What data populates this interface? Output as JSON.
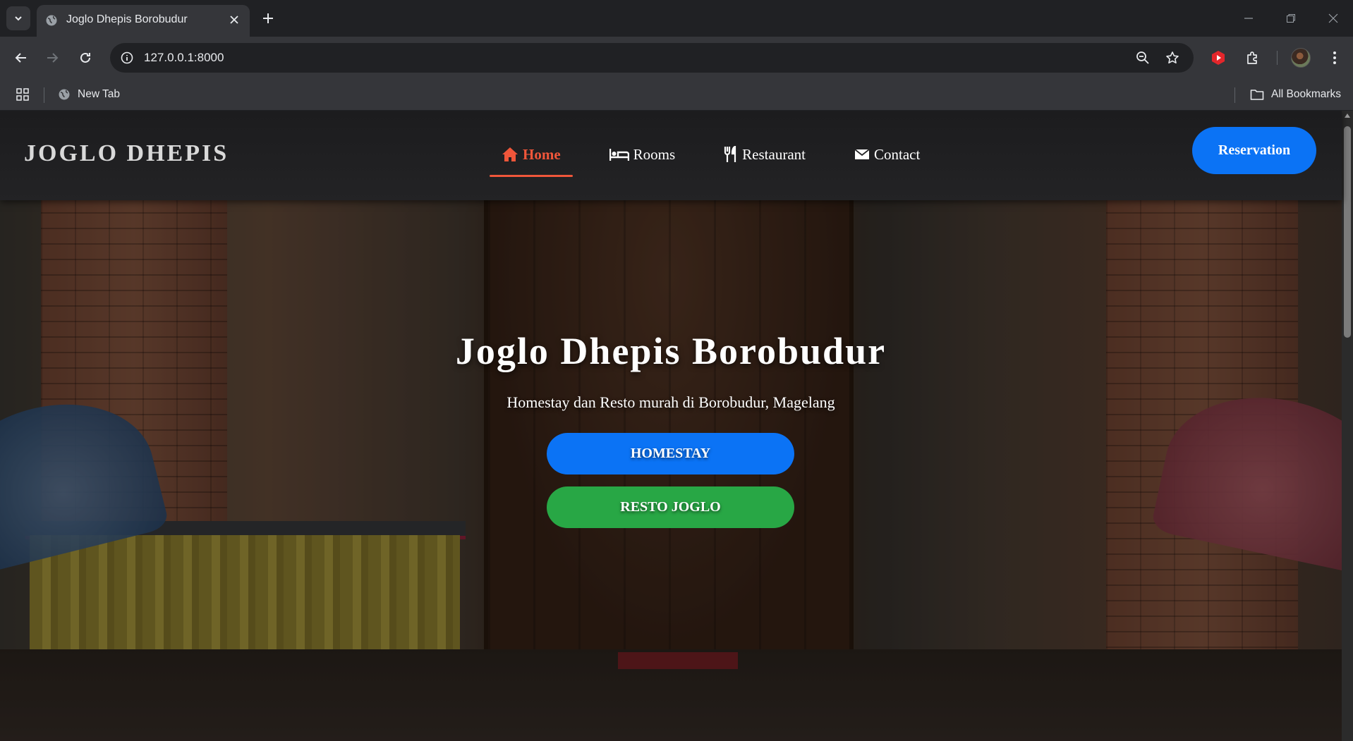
{
  "browser": {
    "tab_title": "Joglo Dhepis Borobudur",
    "url": "127.0.0.1:8000",
    "bookmarks": [
      {
        "label": "New Tab",
        "icon": "globe-icon"
      },
      {
        "label": "All Bookmarks",
        "icon": "folder-icon"
      }
    ]
  },
  "site": {
    "brand": "JOGLO DHEPIS",
    "nav": [
      {
        "label": "Home",
        "icon": "home-icon",
        "active": true
      },
      {
        "label": "Rooms",
        "icon": "bed-icon",
        "active": false
      },
      {
        "label": "Restaurant",
        "icon": "utensils-icon",
        "active": false
      },
      {
        "label": "Contact",
        "icon": "envelope-icon",
        "active": false
      }
    ],
    "reservation_label": "Reservation",
    "hero": {
      "title": "Joglo Dhepis Borobudur",
      "subtitle": "Homestay dan Resto murah di Borobudur, Magelang",
      "primary_button": "HOMESTAY",
      "secondary_button": "RESTO JOGLO"
    }
  },
  "colors": {
    "accent_active": "#f0563a",
    "primary_blue": "#0b73f5",
    "success_green": "#28a745"
  }
}
